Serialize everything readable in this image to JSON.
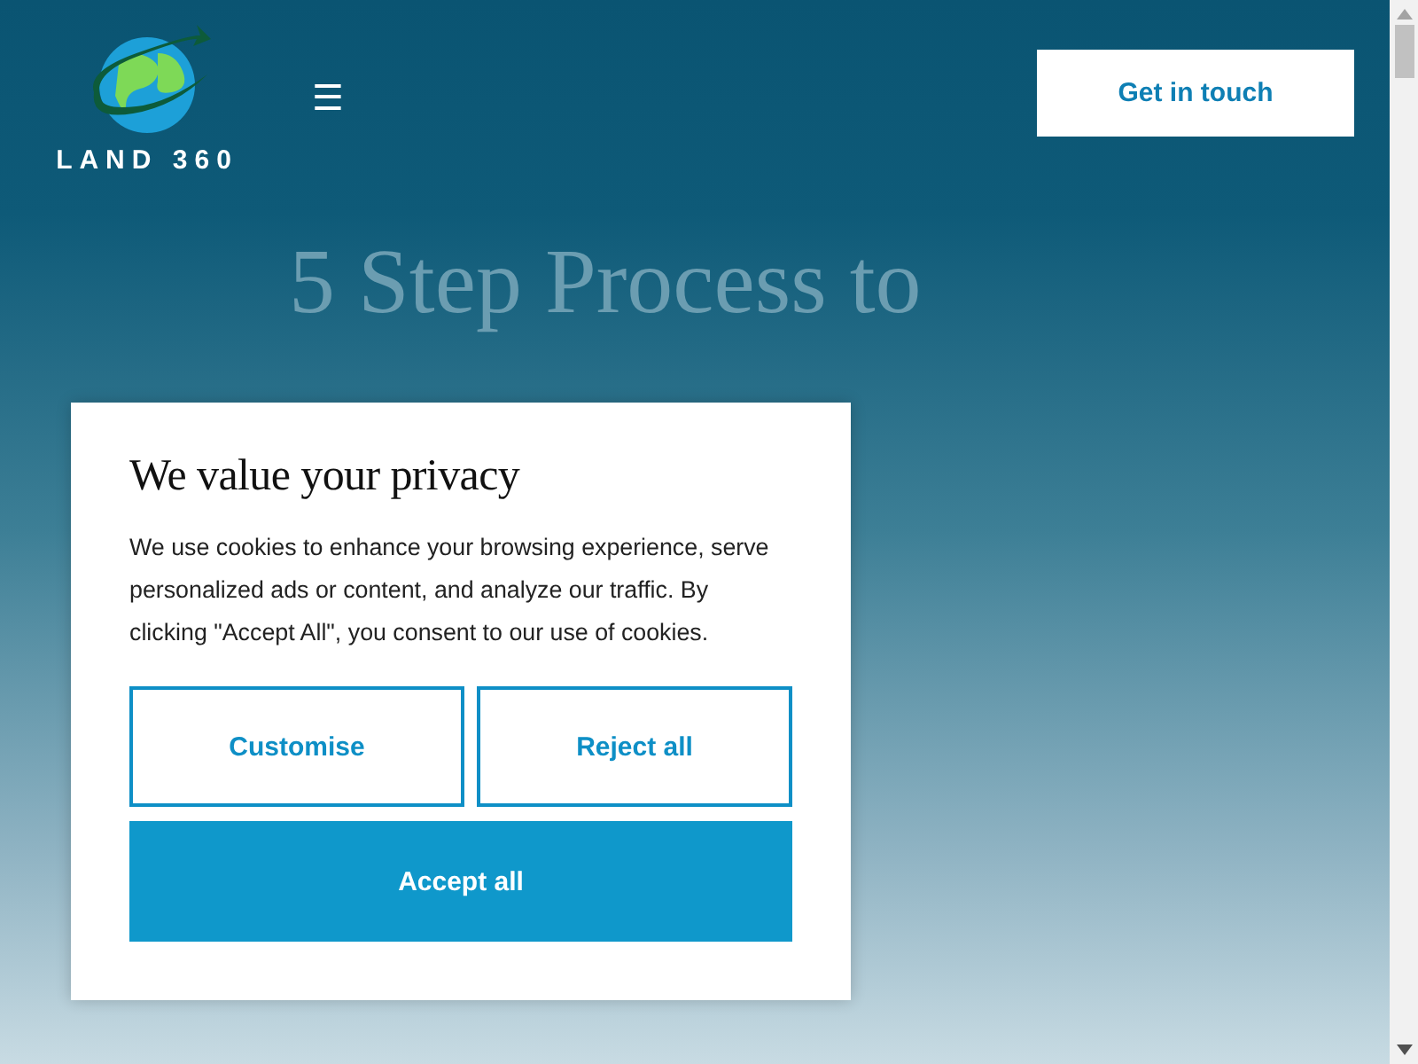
{
  "header": {
    "logo_text": "LAND 360",
    "menu_icon": "☰",
    "cta": "Get in touch"
  },
  "hero": {
    "heading": "5 Step Process to"
  },
  "cookie_dialog": {
    "title": "We value your privacy",
    "body": "We use cookies to enhance your browsing experience, serve personalized ads or content, and analyze our traffic. By clicking \"Accept All\", you consent to our use of cookies.",
    "buttons": [
      {
        "label": "Customise",
        "kind": "outline"
      },
      {
        "label": "Reject all",
        "kind": "outline"
      },
      {
        "label": "Accept all",
        "kind": "filled"
      }
    ]
  }
}
